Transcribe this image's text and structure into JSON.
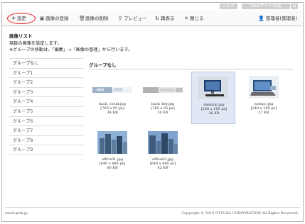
{
  "titlebar": {
    "help_label": "ヘルプ",
    "site_label": "Webサイト作成",
    "close_symbol": "✕"
  },
  "toolbar": {
    "settings_label": "設定",
    "register_label": "画像の登録",
    "delete_label": "画像の削除",
    "preview_label": "プレビュー",
    "refresh_label": "再表示",
    "close_label": "閉じる",
    "user_label": "管理者(管理者)"
  },
  "page": {
    "heading": "画像リスト",
    "description_1": "項目の画像を設定します。",
    "description_2": "※グループの移動は、「編集」→「画像の管理」から行います。"
  },
  "sidebar": {
    "items": [
      {
        "label": "グループなし"
      },
      {
        "label": "グループ1"
      },
      {
        "label": "グループ2"
      },
      {
        "label": "グループ3"
      },
      {
        "label": "グループ4"
      },
      {
        "label": "グループ5"
      },
      {
        "label": "グループ6"
      },
      {
        "label": "グループ7"
      },
      {
        "label": "グループ8"
      },
      {
        "label": "グループ9"
      }
    ]
  },
  "group": {
    "title": "グループなし"
  },
  "images": [
    {
      "name": "back_cloud.jpg",
      "dims": "[760 x 95 px]",
      "size": "34 KB",
      "kind": "strip-blue"
    },
    {
      "name": "back_key.jpg",
      "dims": "[760 x 95 px]",
      "size": "30 KB",
      "kind": "strip-gray"
    },
    {
      "name": "desktop.jpg",
      "dims": "[240 x 180 px]",
      "size": "26 KB",
      "kind": "desktop"
    },
    {
      "name": "notepc.jpg",
      "dims": "[240 x 180 px]",
      "size": "27 KB",
      "kind": "notepc"
    },
    {
      "name": "office01.jpg",
      "dims": "[640 x 480 px]",
      "size": "80 KB",
      "kind": "office"
    },
    {
      "name": "office02.jpg",
      "dims": "[640 x 480 px]",
      "size": "82 KB",
      "kind": "office"
    }
  ],
  "footer": {
    "left": "aweb-prm.jp",
    "right": "Copyright © 2015 OTSUKA CORPORATION All Rights Reserved."
  },
  "colors": {
    "accent_ring": "#dd1111",
    "selected_bg": "#dfe8f4",
    "titlebar_button": "#cfcfcf"
  }
}
